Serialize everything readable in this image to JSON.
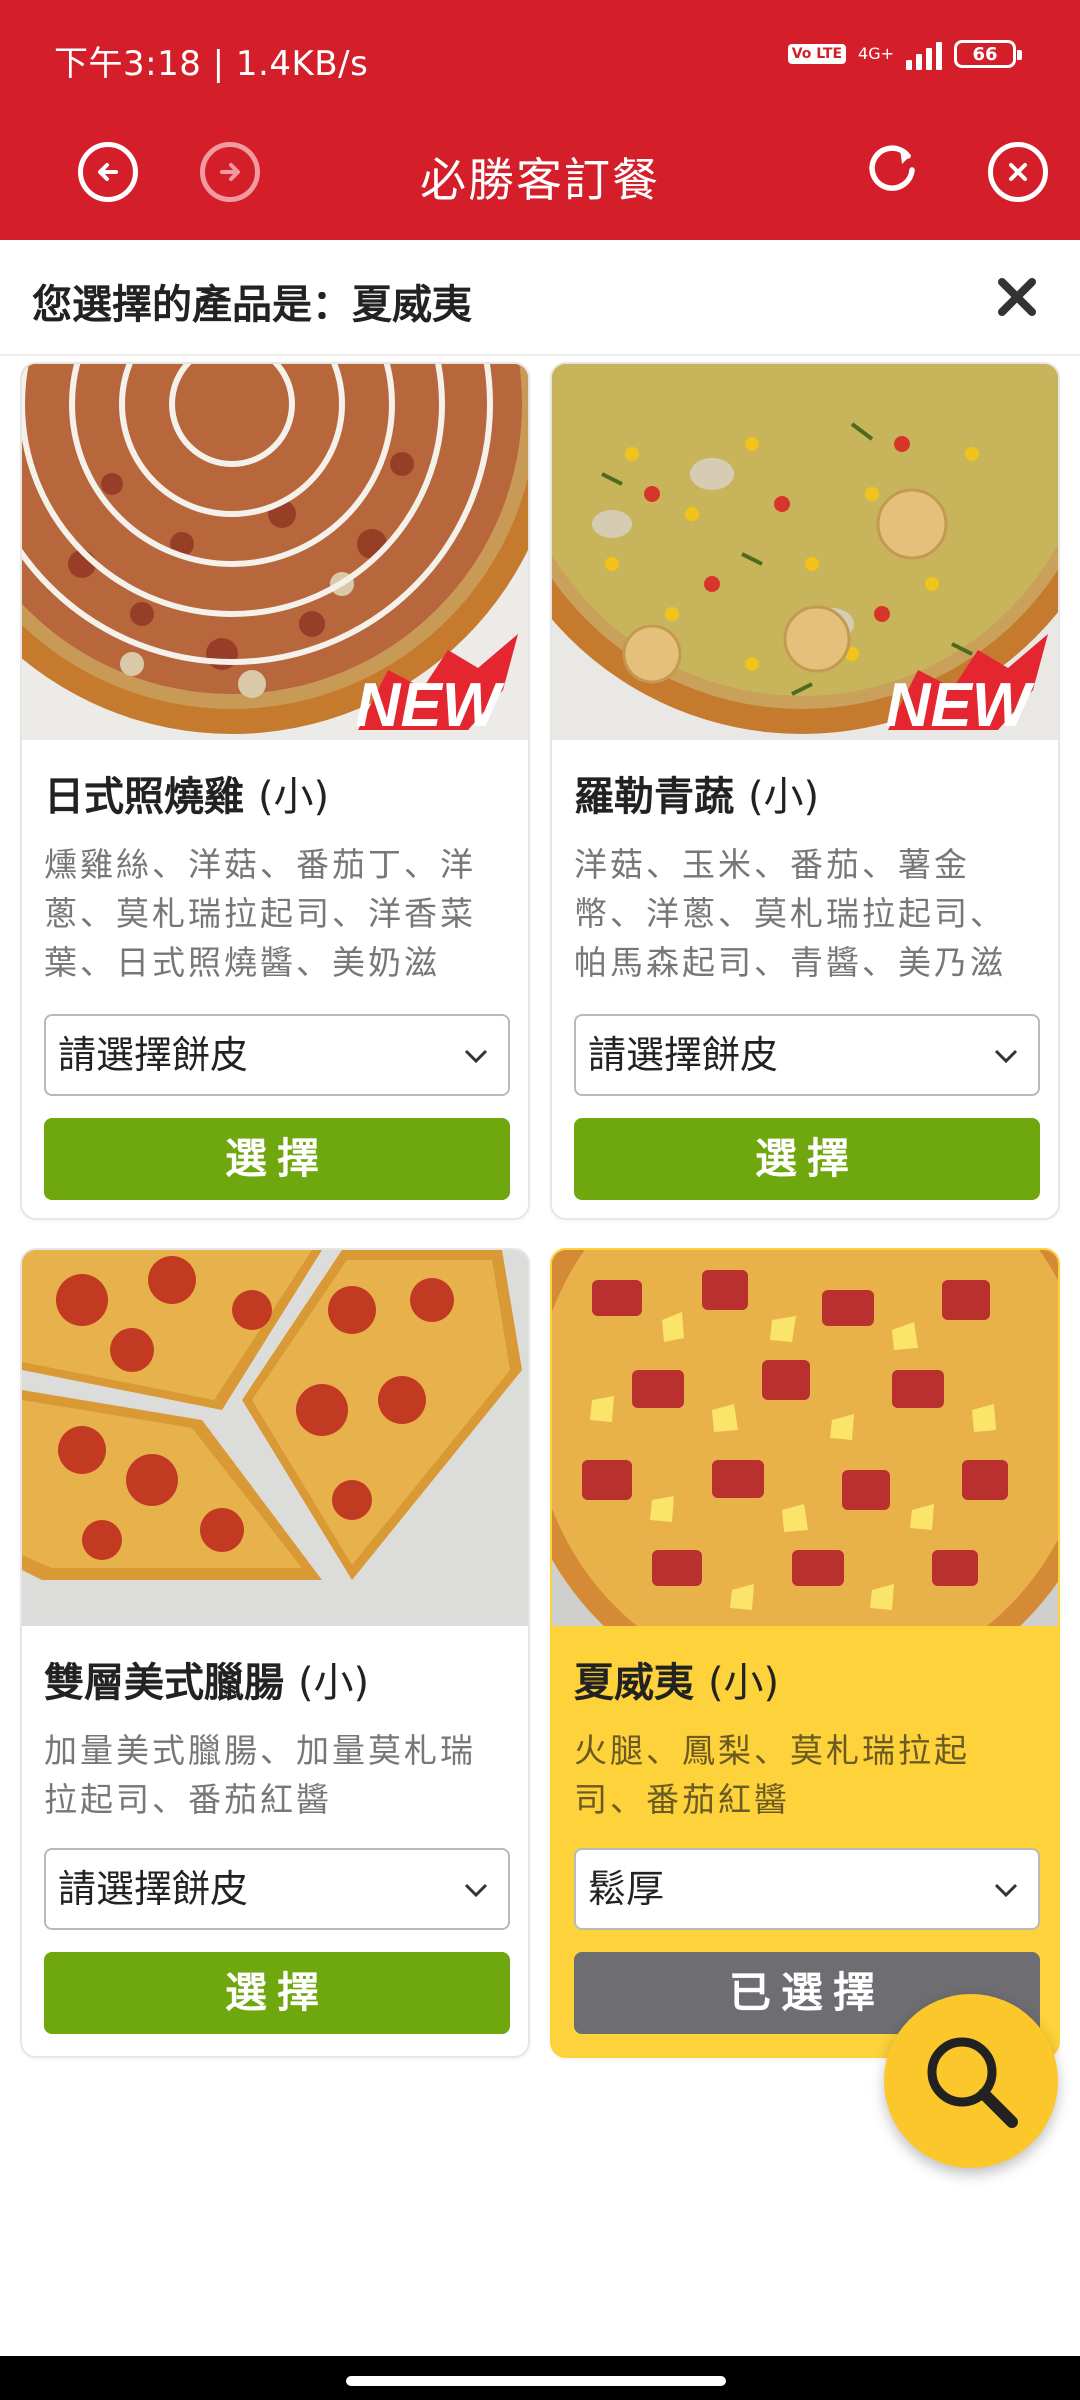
{
  "status_bar": {
    "time": "下午3:18 | 1.4KB/s",
    "volte": "Vo LTE",
    "network": "4G+",
    "battery": "66"
  },
  "header": {
    "title": "必勝客訂餐",
    "back_icon": "arrow-left-circle-icon",
    "forward_icon": "arrow-right-circle-icon",
    "refresh_icon": "refresh-icon",
    "close_icon": "close-circle-icon"
  },
  "banner": {
    "text": "您選擇的產品是：夏威夷"
  },
  "products": [
    {
      "name": "日式照燒雞",
      "size": "(小)",
      "desc": "燻雞絲、洋菇、番茄丁、洋蔥、莫札瑞拉起司、洋香菜葉、日式照燒醬、美奶滋",
      "crust": "請選擇餅皮",
      "button": "選擇",
      "badge": "NEW"
    },
    {
      "name": "羅勒青蔬",
      "size": "(小)",
      "desc": "洋菇、玉米、番茄、薯金幣、洋蔥、莫札瑞拉起司、帕馬森起司、青醬、美乃滋",
      "crust": "請選擇餅皮",
      "button": "選擇",
      "badge": "NEW"
    },
    {
      "name": "雙層美式臘腸",
      "size": "(小)",
      "desc": "加量美式臘腸、加量莫札瑞拉起司、番茄紅醬",
      "crust": "請選擇餅皮",
      "button": "選擇"
    },
    {
      "name": "夏威夷",
      "size": "(小)",
      "desc": "火腿、鳳梨、莫札瑞拉起司、番茄紅醬",
      "crust": "鬆厚",
      "button": "已選擇"
    }
  ],
  "colors": {
    "brand_red": "#d41f2b",
    "select_green": "#6fa80e",
    "selected_yellow": "#fdd23a",
    "selected_gray": "#6d6d72"
  }
}
